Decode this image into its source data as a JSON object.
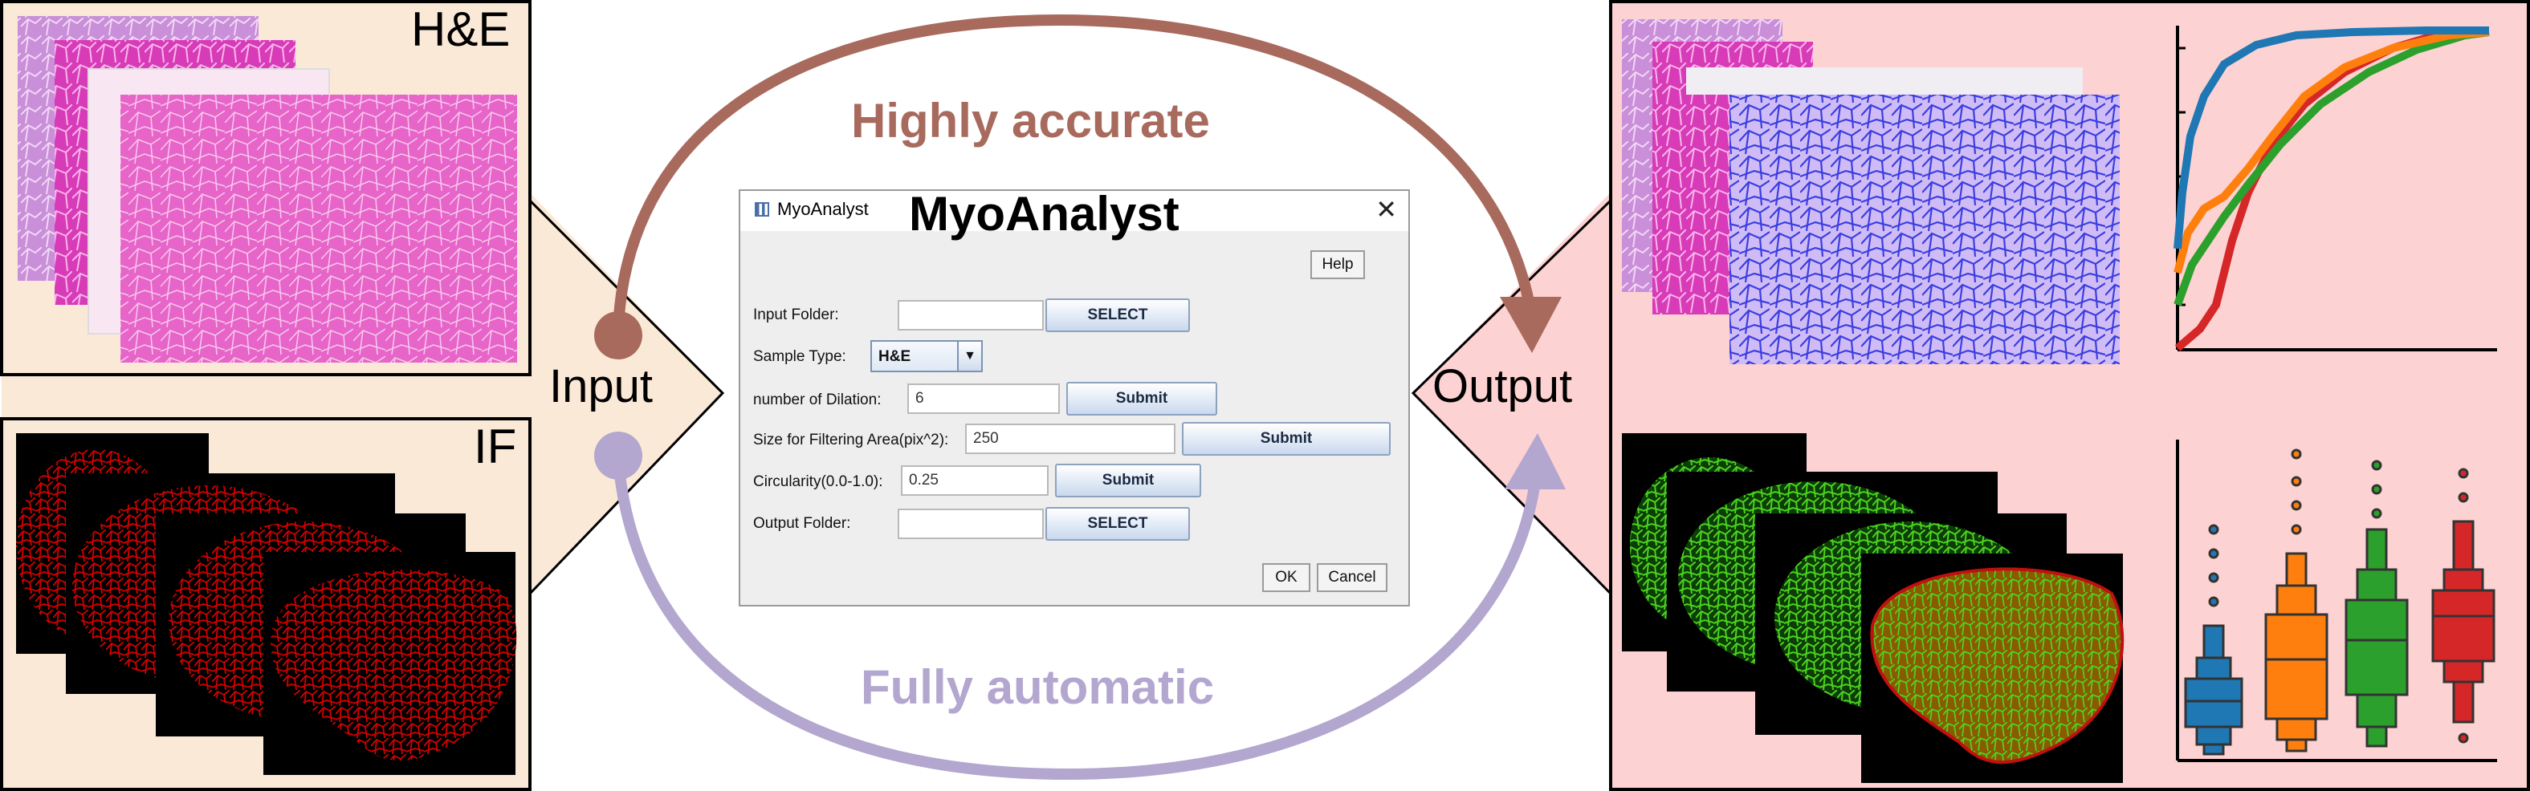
{
  "panels": {
    "he_tag": "H&E",
    "if_tag": "IF"
  },
  "flow": {
    "input_label": "Input",
    "output_label": "Output",
    "top_arc_text": "Highly accurate",
    "bottom_arc_text": "Fully automatic"
  },
  "colors": {
    "panel_bg_input": "#fbe9d8",
    "panel_bg_output": "#fdd2d2",
    "top_arc": "#a86a5d",
    "bottom_arc": "#b3a6cf",
    "he_pink": "#e863c8",
    "if_red": "#d40000",
    "seg_green": "#37c51a",
    "series": [
      "#1f77b4",
      "#ff7f0e",
      "#2ca02c",
      "#d62728"
    ]
  },
  "dialog": {
    "window_title": "MyoAnalyst",
    "overlay_title": "MyoAnalyst",
    "close_glyph": "✕",
    "help_button": "Help",
    "rows": [
      {
        "label": "Input Folder:",
        "value": "",
        "button": "SELECT"
      },
      {
        "label": "Sample Type:",
        "value": "H&E"
      },
      {
        "label": "number of Dilation:",
        "value": "6",
        "button": "Submit"
      },
      {
        "label": "Size for Filtering Area(pix^2):",
        "value": "250",
        "button": "Submit"
      },
      {
        "label": "Circularity(0.0-1.0):",
        "value": "0.25",
        "button": "Submit"
      },
      {
        "label": "Output Folder:",
        "value": "",
        "button": "SELECT"
      }
    ],
    "ok_button": "OK",
    "cancel_button": "Cancel"
  }
}
